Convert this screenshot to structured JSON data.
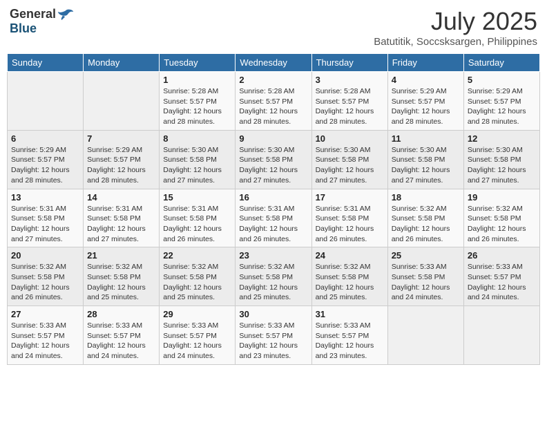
{
  "header": {
    "logo_general": "General",
    "logo_blue": "Blue",
    "month_year": "July 2025",
    "location": "Batutitik, Soccsksargen, Philippines"
  },
  "weekdays": [
    "Sunday",
    "Monday",
    "Tuesday",
    "Wednesday",
    "Thursday",
    "Friday",
    "Saturday"
  ],
  "weeks": [
    [
      {
        "day": "",
        "sunrise": "",
        "sunset": "",
        "daylight": ""
      },
      {
        "day": "",
        "sunrise": "",
        "sunset": "",
        "daylight": ""
      },
      {
        "day": "1",
        "sunrise": "Sunrise: 5:28 AM",
        "sunset": "Sunset: 5:57 PM",
        "daylight": "Daylight: 12 hours and 28 minutes."
      },
      {
        "day": "2",
        "sunrise": "Sunrise: 5:28 AM",
        "sunset": "Sunset: 5:57 PM",
        "daylight": "Daylight: 12 hours and 28 minutes."
      },
      {
        "day": "3",
        "sunrise": "Sunrise: 5:28 AM",
        "sunset": "Sunset: 5:57 PM",
        "daylight": "Daylight: 12 hours and 28 minutes."
      },
      {
        "day": "4",
        "sunrise": "Sunrise: 5:29 AM",
        "sunset": "Sunset: 5:57 PM",
        "daylight": "Daylight: 12 hours and 28 minutes."
      },
      {
        "day": "5",
        "sunrise": "Sunrise: 5:29 AM",
        "sunset": "Sunset: 5:57 PM",
        "daylight": "Daylight: 12 hours and 28 minutes."
      }
    ],
    [
      {
        "day": "6",
        "sunrise": "Sunrise: 5:29 AM",
        "sunset": "Sunset: 5:57 PM",
        "daylight": "Daylight: 12 hours and 28 minutes."
      },
      {
        "day": "7",
        "sunrise": "Sunrise: 5:29 AM",
        "sunset": "Sunset: 5:57 PM",
        "daylight": "Daylight: 12 hours and 28 minutes."
      },
      {
        "day": "8",
        "sunrise": "Sunrise: 5:30 AM",
        "sunset": "Sunset: 5:58 PM",
        "daylight": "Daylight: 12 hours and 27 minutes."
      },
      {
        "day": "9",
        "sunrise": "Sunrise: 5:30 AM",
        "sunset": "Sunset: 5:58 PM",
        "daylight": "Daylight: 12 hours and 27 minutes."
      },
      {
        "day": "10",
        "sunrise": "Sunrise: 5:30 AM",
        "sunset": "Sunset: 5:58 PM",
        "daylight": "Daylight: 12 hours and 27 minutes."
      },
      {
        "day": "11",
        "sunrise": "Sunrise: 5:30 AM",
        "sunset": "Sunset: 5:58 PM",
        "daylight": "Daylight: 12 hours and 27 minutes."
      },
      {
        "day": "12",
        "sunrise": "Sunrise: 5:30 AM",
        "sunset": "Sunset: 5:58 PM",
        "daylight": "Daylight: 12 hours and 27 minutes."
      }
    ],
    [
      {
        "day": "13",
        "sunrise": "Sunrise: 5:31 AM",
        "sunset": "Sunset: 5:58 PM",
        "daylight": "Daylight: 12 hours and 27 minutes."
      },
      {
        "day": "14",
        "sunrise": "Sunrise: 5:31 AM",
        "sunset": "Sunset: 5:58 PM",
        "daylight": "Daylight: 12 hours and 27 minutes."
      },
      {
        "day": "15",
        "sunrise": "Sunrise: 5:31 AM",
        "sunset": "Sunset: 5:58 PM",
        "daylight": "Daylight: 12 hours and 26 minutes."
      },
      {
        "day": "16",
        "sunrise": "Sunrise: 5:31 AM",
        "sunset": "Sunset: 5:58 PM",
        "daylight": "Daylight: 12 hours and 26 minutes."
      },
      {
        "day": "17",
        "sunrise": "Sunrise: 5:31 AM",
        "sunset": "Sunset: 5:58 PM",
        "daylight": "Daylight: 12 hours and 26 minutes."
      },
      {
        "day": "18",
        "sunrise": "Sunrise: 5:32 AM",
        "sunset": "Sunset: 5:58 PM",
        "daylight": "Daylight: 12 hours and 26 minutes."
      },
      {
        "day": "19",
        "sunrise": "Sunrise: 5:32 AM",
        "sunset": "Sunset: 5:58 PM",
        "daylight": "Daylight: 12 hours and 26 minutes."
      }
    ],
    [
      {
        "day": "20",
        "sunrise": "Sunrise: 5:32 AM",
        "sunset": "Sunset: 5:58 PM",
        "daylight": "Daylight: 12 hours and 26 minutes."
      },
      {
        "day": "21",
        "sunrise": "Sunrise: 5:32 AM",
        "sunset": "Sunset: 5:58 PM",
        "daylight": "Daylight: 12 hours and 25 minutes."
      },
      {
        "day": "22",
        "sunrise": "Sunrise: 5:32 AM",
        "sunset": "Sunset: 5:58 PM",
        "daylight": "Daylight: 12 hours and 25 minutes."
      },
      {
        "day": "23",
        "sunrise": "Sunrise: 5:32 AM",
        "sunset": "Sunset: 5:58 PM",
        "daylight": "Daylight: 12 hours and 25 minutes."
      },
      {
        "day": "24",
        "sunrise": "Sunrise: 5:32 AM",
        "sunset": "Sunset: 5:58 PM",
        "daylight": "Daylight: 12 hours and 25 minutes."
      },
      {
        "day": "25",
        "sunrise": "Sunrise: 5:33 AM",
        "sunset": "Sunset: 5:58 PM",
        "daylight": "Daylight: 12 hours and 24 minutes."
      },
      {
        "day": "26",
        "sunrise": "Sunrise: 5:33 AM",
        "sunset": "Sunset: 5:57 PM",
        "daylight": "Daylight: 12 hours and 24 minutes."
      }
    ],
    [
      {
        "day": "27",
        "sunrise": "Sunrise: 5:33 AM",
        "sunset": "Sunset: 5:57 PM",
        "daylight": "Daylight: 12 hours and 24 minutes."
      },
      {
        "day": "28",
        "sunrise": "Sunrise: 5:33 AM",
        "sunset": "Sunset: 5:57 PM",
        "daylight": "Daylight: 12 hours and 24 minutes."
      },
      {
        "day": "29",
        "sunrise": "Sunrise: 5:33 AM",
        "sunset": "Sunset: 5:57 PM",
        "daylight": "Daylight: 12 hours and 24 minutes."
      },
      {
        "day": "30",
        "sunrise": "Sunrise: 5:33 AM",
        "sunset": "Sunset: 5:57 PM",
        "daylight": "Daylight: 12 hours and 23 minutes."
      },
      {
        "day": "31",
        "sunrise": "Sunrise: 5:33 AM",
        "sunset": "Sunset: 5:57 PM",
        "daylight": "Daylight: 12 hours and 23 minutes."
      },
      {
        "day": "",
        "sunrise": "",
        "sunset": "",
        "daylight": ""
      },
      {
        "day": "",
        "sunrise": "",
        "sunset": "",
        "daylight": ""
      }
    ]
  ]
}
